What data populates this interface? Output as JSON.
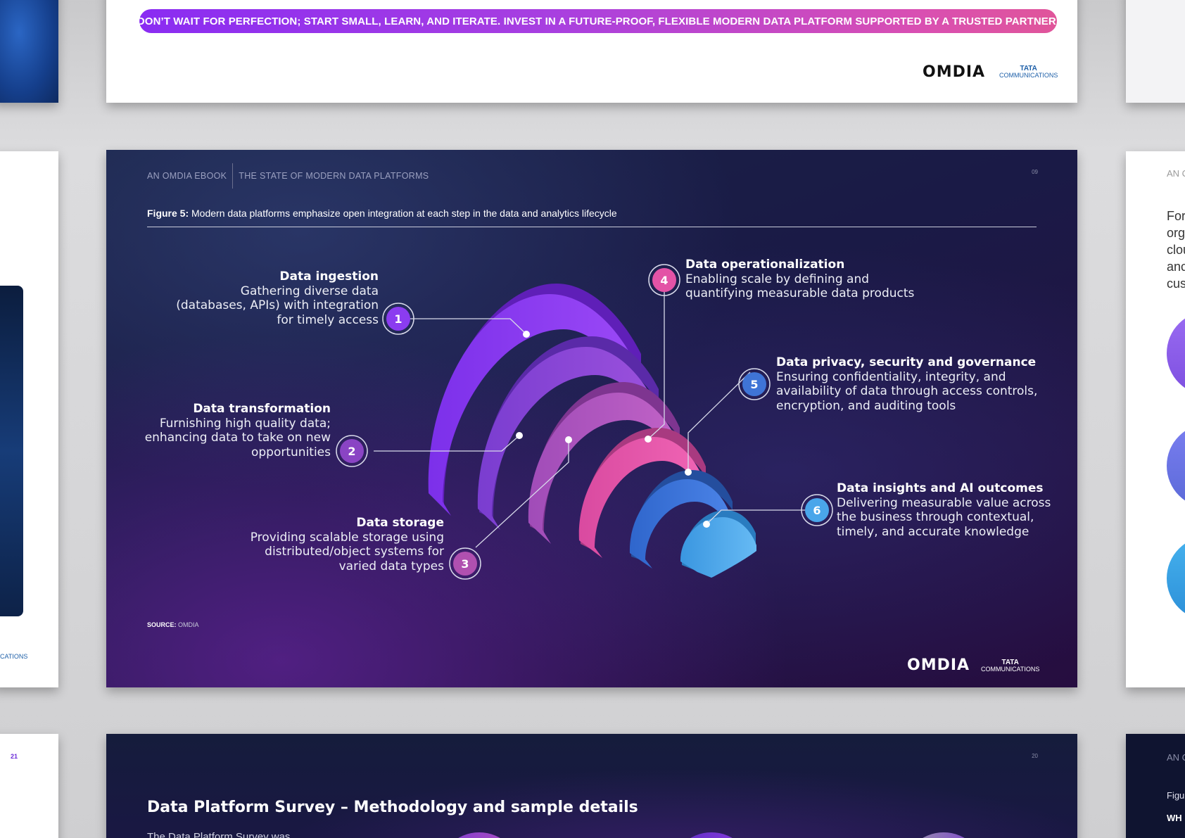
{
  "top_page": {
    "banner": "DON’T WAIT FOR PERFECTION; START SMALL, LEARN, AND ITERATE. INVEST IN A FUTURE-PROOF, FLEXIBLE MODERN DATA PLATFORM SUPPORTED BY A TRUSTED PARTNER.",
    "omdia_logo": "OMDIA",
    "tata_logo": {
      "line1": "TATA",
      "line2": "COMMUNICATIONS"
    }
  },
  "main_slide": {
    "header": {
      "left": "AN OMDIA EBOOK",
      "right": "THE STATE OF MODERN DATA PLATFORMS"
    },
    "page_number": "09",
    "caption": {
      "prefix": "Figure 5:",
      "text": " Modern data platforms emphasize open integration at each step in the data and analytics lifecycle"
    },
    "steps": [
      {
        "number": "1",
        "title": "Data ingestion",
        "description_lines": [
          "Gathering diverse data",
          "(databases, APIs) with integration",
          "for timely access"
        ],
        "color": "#8b3cf0"
      },
      {
        "number": "2",
        "title": "Data transformation",
        "description_lines": [
          "Furnishing high quality data;",
          "enhancing data to take on new",
          "opportunities"
        ],
        "color": "#8a44c4"
      },
      {
        "number": "3",
        "title": "Data storage",
        "description_lines": [
          "Providing scalable storage using",
          "distributed/object systems for",
          "varied data types"
        ],
        "color": "#b050b0"
      },
      {
        "number": "4",
        "title": "Data operationalization",
        "description_lines": [
          "Enabling scale by defining and",
          "quantifying measurable data products"
        ],
        "color": "#e353a6"
      },
      {
        "number": "5",
        "title": "Data privacy, security and governance",
        "description_lines": [
          "Ensuring confidentiality, integrity, and",
          "availability of data through access controls,",
          "encryption, and auditing tools"
        ],
        "color": "#3f74d6"
      },
      {
        "number": "6",
        "title": "Data insights and AI outcomes",
        "description_lines": [
          "Delivering measurable value across",
          "the business through contextual,",
          "timely, and accurate knowledge"
        ],
        "color": "#4aa6ea"
      }
    ],
    "source": {
      "label": "SOURCE:",
      "text": " OMDIA"
    },
    "omdia_logo": "OMDIA",
    "tata_logo": {
      "line1": "TATA",
      "line2": "COMMUNICATIONS"
    }
  },
  "bottom_page": {
    "page_number": "20",
    "title": "Data Platform Survey – Methodology and sample details",
    "subtitle": "The Data Platform Survey was"
  },
  "left_pages": {
    "middle_logo_fragment": "CATIONS",
    "bottom_page_number": "21"
  },
  "right_pages": {
    "middle_header_fragment": "AN C",
    "middle_paragraph_fragments": [
      "For",
      "org",
      "clou",
      "anc",
      "cus"
    ],
    "bottom_header_fragment": "AN C",
    "bottom_figure_fragment": "Figu",
    "bottom_heading_fragment": "WH"
  }
}
